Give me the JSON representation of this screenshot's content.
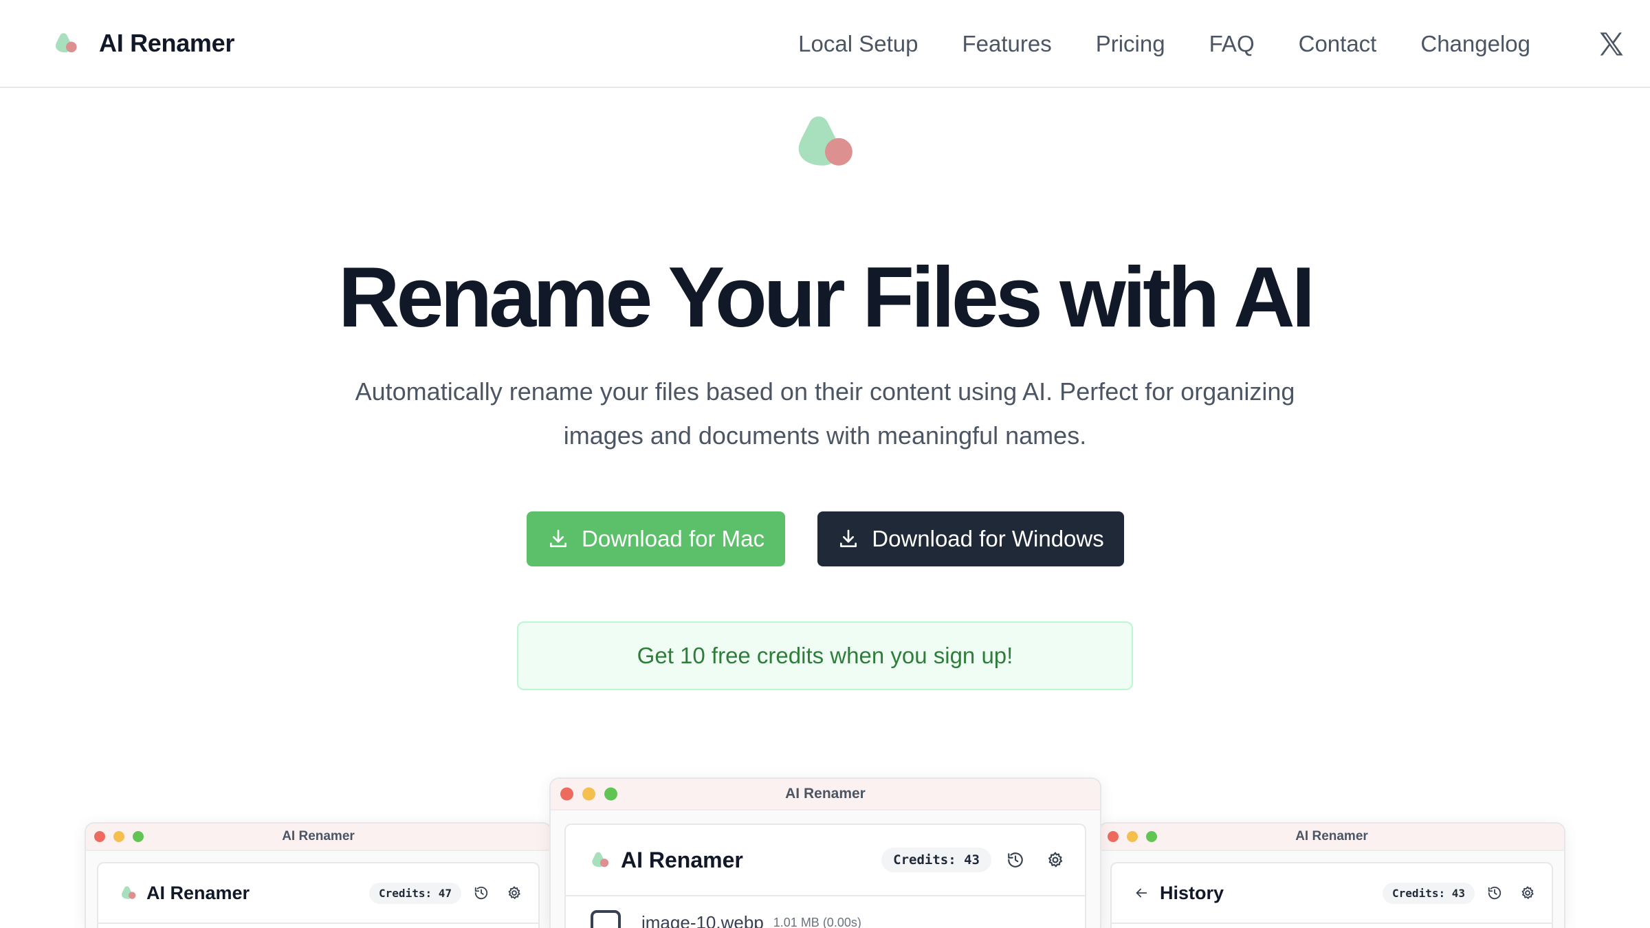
{
  "header": {
    "brand": "AI Renamer",
    "nav": [
      "Local Setup",
      "Features",
      "Pricing",
      "FAQ",
      "Contact",
      "Changelog"
    ],
    "social_icon": "x-icon"
  },
  "hero": {
    "title": "Rename Your Files with AI",
    "subtitle": "Automatically rename your files based on their content using AI. Perfect for organizing images and documents with meaningful names.",
    "download_mac": "Download for Mac",
    "download_windows": "Download for Windows",
    "promo": "Get 10 free credits when you sign up!"
  },
  "colors": {
    "logo_green": "#a8dfbd",
    "logo_red": "#dc9090",
    "mac_button": "#5cc06a",
    "windows_button": "#1f2937",
    "promo_text": "#2f7d3a"
  },
  "windows": {
    "left": {
      "title": "AI Renamer",
      "app_name": "AI Renamer",
      "credits": "Credits: 47"
    },
    "center": {
      "title": "AI Renamer",
      "app_name": "AI Renamer",
      "credits": "Credits: 43",
      "file_name": "image-10.webp",
      "file_meta": "1.01 MB (0.00s)"
    },
    "right": {
      "title": "AI Renamer",
      "view_title": "History",
      "credits": "Credits: 43"
    }
  }
}
